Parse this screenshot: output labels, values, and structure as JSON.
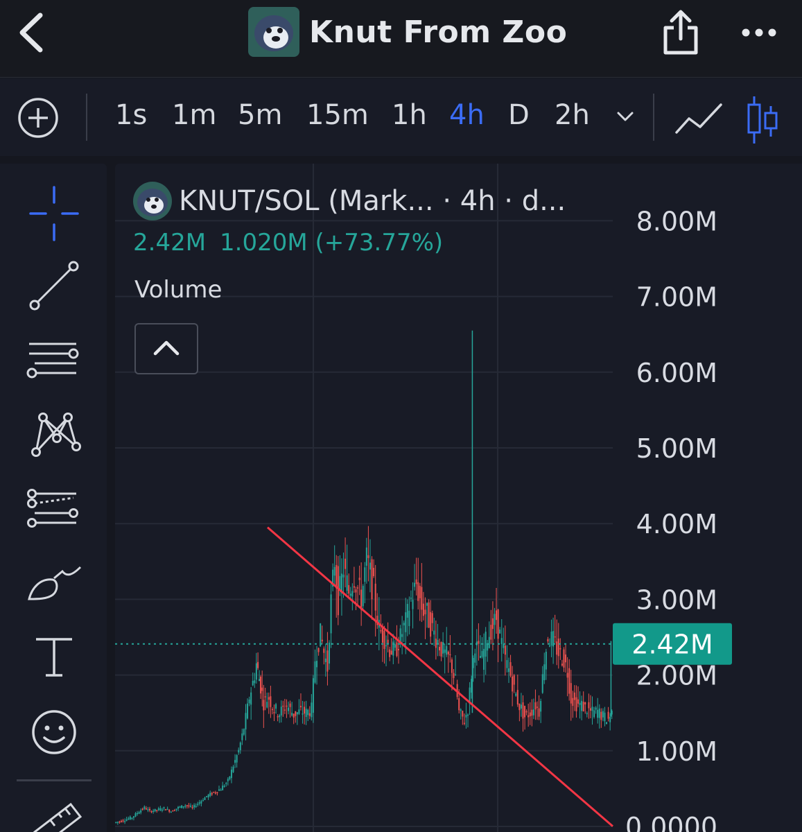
{
  "header": {
    "title": "Knut From Zoo",
    "icons": [
      "back-arrow-icon",
      "share-icon",
      "more-icon"
    ]
  },
  "toolbar": {
    "timeframes": [
      "1s",
      "1m",
      "5m",
      "15m",
      "1h",
      "4h",
      "D",
      "2h"
    ],
    "active_timeframe": "4h",
    "icons": [
      "add-icon",
      "chevron-down-icon",
      "line-chart-icon",
      "candlestick-icon"
    ]
  },
  "sidebar": {
    "tools": [
      "crosshair-icon",
      "trend-line-icon",
      "horizontal-lines-icon",
      "pattern-icon",
      "fib-icon",
      "brush-icon",
      "text-icon",
      "emoji-icon",
      "ruler-icon"
    ]
  },
  "legend": {
    "symbol": "KNUT/SOL (Mark... · 4h · d...",
    "price": "2.42M",
    "change": "1.020M (+73.77%)",
    "indicator": "Volume"
  },
  "colors": {
    "up": "#26a69a",
    "down": "#ef5350",
    "trendline": "#f23645",
    "active": "#3b6cf5",
    "background": "#181b26"
  },
  "chart_data": {
    "type": "candlestick",
    "y_ticks": [
      "8.00M",
      "7.00M",
      "6.00M",
      "5.00M",
      "4.00M",
      "3.00M",
      "2.00M",
      "1.00M",
      "0.0000"
    ],
    "ylim": [
      0,
      8.4
    ],
    "unit": "M",
    "last_price": 2.42,
    "last_price_label": "2.42M",
    "price_path": [
      [
        0,
        0.05
      ],
      [
        10,
        0.08
      ],
      [
        20,
        0.12
      ],
      [
        28,
        0.2
      ],
      [
        34,
        0.25
      ],
      [
        40,
        0.2
      ],
      [
        48,
        0.22
      ],
      [
        56,
        0.24
      ],
      [
        64,
        0.2
      ],
      [
        72,
        0.25
      ],
      [
        80,
        0.28
      ],
      [
        88,
        0.25
      ],
      [
        96,
        0.32
      ],
      [
        104,
        0.4
      ],
      [
        112,
        0.45
      ],
      [
        120,
        0.5
      ],
      [
        128,
        0.6
      ],
      [
        134,
        0.8
      ],
      [
        140,
        1.0
      ],
      [
        146,
        1.3
      ],
      [
        152,
        1.7
      ],
      [
        158,
        2.0
      ],
      [
        160,
        2.15
      ],
      [
        163,
        1.95
      ],
      [
        168,
        1.65
      ],
      [
        174,
        1.7
      ],
      [
        180,
        1.55
      ],
      [
        186,
        1.5
      ],
      [
        194,
        1.6
      ],
      [
        202,
        1.48
      ],
      [
        210,
        1.52
      ],
      [
        216,
        1.5
      ],
      [
        222,
        1.55
      ],
      [
        226,
        2.2
      ],
      [
        232,
        2.55
      ],
      [
        236,
        2.3
      ],
      [
        240,
        2.1
      ],
      [
        244,
        3.0
      ],
      [
        248,
        3.5
      ],
      [
        252,
        3.0
      ],
      [
        258,
        3.4
      ],
      [
        264,
        3.1
      ],
      [
        270,
        3.3
      ],
      [
        278,
        3.0
      ],
      [
        284,
        3.55
      ],
      [
        292,
        3.1
      ],
      [
        298,
        2.6
      ],
      [
        304,
        2.5
      ],
      [
        310,
        2.35
      ],
      [
        316,
        2.3
      ],
      [
        322,
        2.5
      ],
      [
        328,
        2.7
      ],
      [
        334,
        3.0
      ],
      [
        340,
        3.2
      ],
      [
        346,
        2.9
      ],
      [
        352,
        2.8
      ],
      [
        358,
        2.6
      ],
      [
        364,
        2.45
      ],
      [
        370,
        2.3
      ],
      [
        378,
        2.2
      ],
      [
        384,
        1.9
      ],
      [
        388,
        1.5
      ],
      [
        394,
        1.4
      ],
      [
        398,
        1.55
      ],
      [
        402,
        2.0
      ],
      [
        406,
        2.4
      ],
      [
        410,
        2.3
      ],
      [
        414,
        2.2
      ],
      [
        418,
        2.45
      ],
      [
        424,
        2.6
      ],
      [
        430,
        2.75
      ],
      [
        436,
        2.4
      ],
      [
        440,
        2.2
      ],
      [
        446,
        2.0
      ],
      [
        450,
        1.8
      ],
      [
        456,
        1.6
      ],
      [
        462,
        1.45
      ],
      [
        468,
        1.5
      ],
      [
        474,
        1.6
      ],
      [
        478,
        1.52
      ],
      [
        484,
        2.2
      ],
      [
        488,
        2.5
      ],
      [
        494,
        2.45
      ],
      [
        500,
        2.3
      ],
      [
        506,
        2.2
      ],
      [
        510,
        2.05
      ],
      [
        514,
        1.7
      ],
      [
        520,
        1.62
      ],
      [
        526,
        1.6
      ],
      [
        532,
        1.55
      ],
      [
        538,
        1.5
      ],
      [
        544,
        1.52
      ],
      [
        550,
        1.45
      ],
      [
        556,
        1.42
      ],
      [
        560,
        1.5
      ]
    ],
    "spikes": [
      {
        "x": 402,
        "high": 6.55,
        "low": 1.5
      },
      {
        "x": 558,
        "high": 2.45,
        "low": 1.45
      }
    ],
    "trendline": [
      [
        222,
        2.9
      ],
      [
        718,
        3.95
      ]
    ],
    "trendline_values": [
      [
        0,
        3.95
      ],
      [
        1,
        0.35
      ]
    ],
    "series": [
      {
        "values": []
      }
    ]
  }
}
